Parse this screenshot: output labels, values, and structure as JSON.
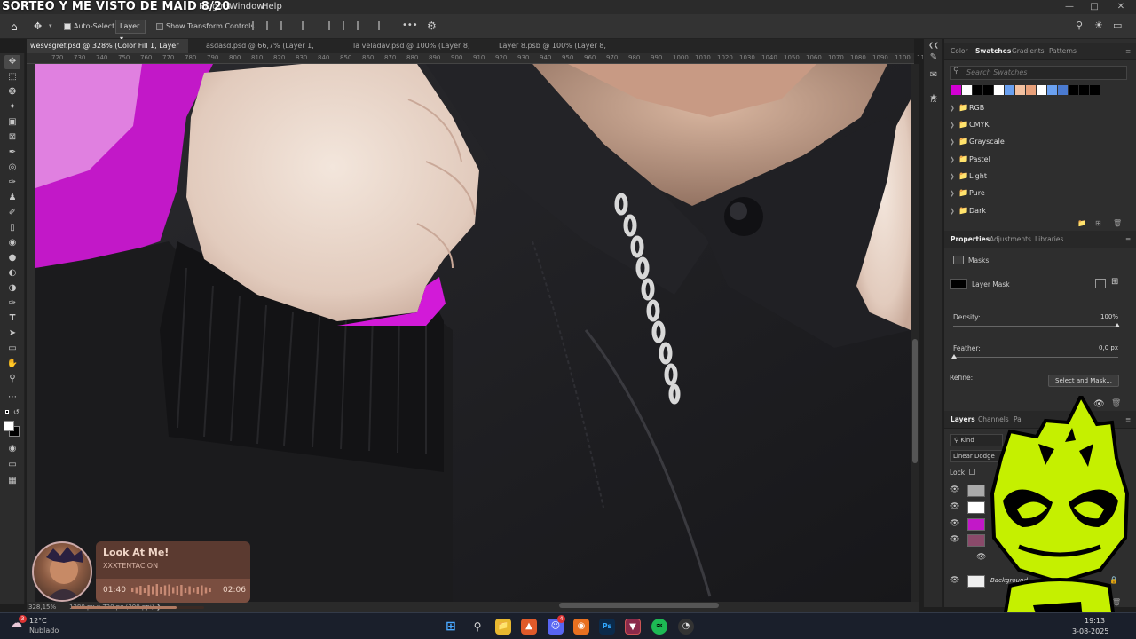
{
  "stream_overlay": {
    "title": "SORTEO Y ME VISTO DE MAID 8/20"
  },
  "menubar": {
    "items": [
      "Plugins",
      "Window",
      "Help"
    ]
  },
  "options_bar": {
    "auto_select_label": "Auto-Select:",
    "auto_select_value": "Layer",
    "transform_controls_label": "Show Transform Controls",
    "more_label": "•••"
  },
  "tabs": [
    {
      "label": "wesvsgref.psd @ 328% (Color Fill 1, Layer Mask/8)",
      "close": "×"
    },
    {
      "label": "asdasd.psd @ 66,7% (Layer 1, RGB/16#) *",
      "close": "×"
    },
    {
      "label": "la veladav.psd @ 100% (Layer 8, RGB/8#)",
      "close": "×"
    },
    {
      "label": "Layer 8.psb @ 100% (Layer 8, RGB/8#)",
      "close": "×"
    }
  ],
  "ruler_ticks": [
    "720",
    "730",
    "740",
    "750",
    "760",
    "770",
    "780",
    "790",
    "800",
    "810",
    "820",
    "830",
    "840",
    "850",
    "860",
    "870",
    "880",
    "890",
    "900",
    "910",
    "920",
    "930",
    "940",
    "950",
    "960",
    "970",
    "980",
    "990",
    "1000",
    "1010",
    "1020",
    "1030",
    "1040",
    "1050",
    "1060",
    "1070",
    "1080",
    "1090",
    "1100",
    "1110"
  ],
  "status_bar": {
    "zoom": "328,15%",
    "dimensions": "1280 px x 720 px (300 ppi)"
  },
  "swatches_panel": {
    "tabs": [
      "Color",
      "Swatches",
      "Gradients",
      "Patterns"
    ],
    "active_tab": "Swatches",
    "search_placeholder": "Search Swatches",
    "swatch_colors": [
      "#d400d4",
      "#ffffff",
      "#000000",
      "#000000",
      "#ffffff",
      "#6aa0f0",
      "#f2c0a0",
      "#e8a07a",
      "#ffffff",
      "#6aa0f0",
      "#4a7ad0",
      "#000000",
      "#000000",
      "#000000"
    ],
    "folders": [
      "RGB",
      "CMYK",
      "Grayscale",
      "Pastel",
      "Light",
      "Pure",
      "Dark"
    ]
  },
  "properties_panel": {
    "tabs": [
      "Properties",
      "Adjustments",
      "Libraries"
    ],
    "active_tab": "Properties",
    "section_label": "Masks",
    "layer_mask_label": "Layer Mask",
    "density_label": "Density:",
    "density_value": "100%",
    "feather_label": "Feather:",
    "feather_value": "0,0 px",
    "refine_label": "Refine:",
    "select_and_mask_label": "Select and Mask..."
  },
  "layers_panel": {
    "tabs": [
      "Layers",
      "Channels",
      "Pa"
    ],
    "active_tab": "Layers",
    "filter_label": "Kind",
    "blend_mode": "Linear Dodge",
    "lock_label": "Lock:",
    "background_layer": "Background"
  },
  "music_widget": {
    "song": "Look At Me!",
    "artist": "XXXTENTACION",
    "current_time": "01:40",
    "total_time": "02:06",
    "progress": 0.79
  },
  "taskbar": {
    "weather_temp": "12°C",
    "weather_desc": "Nublado",
    "weather_badge": "3",
    "time": "19:13",
    "date": "3-08-2025",
    "discord_badge": "4"
  },
  "colors": {
    "ps_bg": "#1e1e1e",
    "panel_bg": "#2e2e2e",
    "accent_magenta": "#d400d4",
    "mascot_green": "#c5f000"
  }
}
